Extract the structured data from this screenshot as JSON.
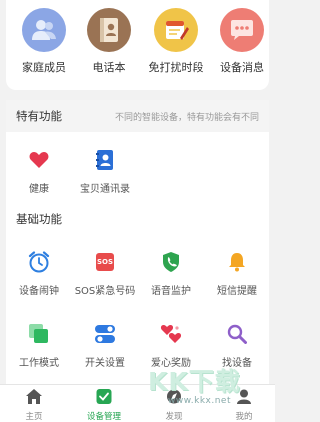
{
  "top_shortcuts": [
    {
      "label": "家庭成员",
      "icon": "family-members-icon"
    },
    {
      "label": "电话本",
      "icon": "phonebook-icon"
    },
    {
      "label": "免打扰时段",
      "icon": "do-not-disturb-icon"
    },
    {
      "label": "设备消息",
      "icon": "device-messages-icon"
    }
  ],
  "special": {
    "title": "特有功能",
    "note": "不同的智能设备，特有功能会有不同",
    "items": [
      {
        "label": "健康",
        "icon": "heart-icon"
      },
      {
        "label": "宝贝通讯录",
        "icon": "contacts-book-icon"
      }
    ]
  },
  "basic": {
    "title": "基础功能",
    "items": [
      {
        "label": "设备闹钟",
        "icon": "alarm-clock-icon"
      },
      {
        "label": "SOS紧急号码",
        "icon": "sos-icon",
        "icon_text": "SOS"
      },
      {
        "label": "语音监护",
        "icon": "voice-monitor-icon"
      },
      {
        "label": "短信提醒",
        "icon": "bell-icon"
      },
      {
        "label": "工作模式",
        "icon": "work-mode-icon"
      },
      {
        "label": "开关设置",
        "icon": "toggle-settings-icon"
      },
      {
        "label": "爱心奖励",
        "icon": "hearts-reward-icon"
      },
      {
        "label": "找设备",
        "icon": "find-device-icon"
      }
    ]
  },
  "bottom_nav": [
    {
      "label": "主页",
      "icon": "home-icon",
      "active": false
    },
    {
      "label": "设备管理",
      "icon": "device-manage-icon",
      "active": true
    },
    {
      "label": "发现",
      "icon": "discover-icon",
      "active": false
    },
    {
      "label": "我的",
      "icon": "profile-icon",
      "active": false
    }
  ],
  "watermark": {
    "text": "KK下载",
    "url": "www.kkx.net"
  },
  "colors": {
    "accent_green": "#27a653",
    "family_blue": "#8ba6e5",
    "phonebook_brown": "#9a7354",
    "dnd_yellow": "#f0c448",
    "messages_red": "#ee7d74",
    "health_red": "#e5384f",
    "contacts_blue": "#2b6fd6",
    "alarm_blue": "#2e7fe0",
    "sos_red": "#e84c4c",
    "voice_green": "#2ea44f",
    "bell_orange": "#f4a623",
    "work_green": "#2eb860",
    "toggle_blue": "#2e79e0",
    "reward_red": "#e5384f",
    "find_purple": "#8e5fc9"
  }
}
